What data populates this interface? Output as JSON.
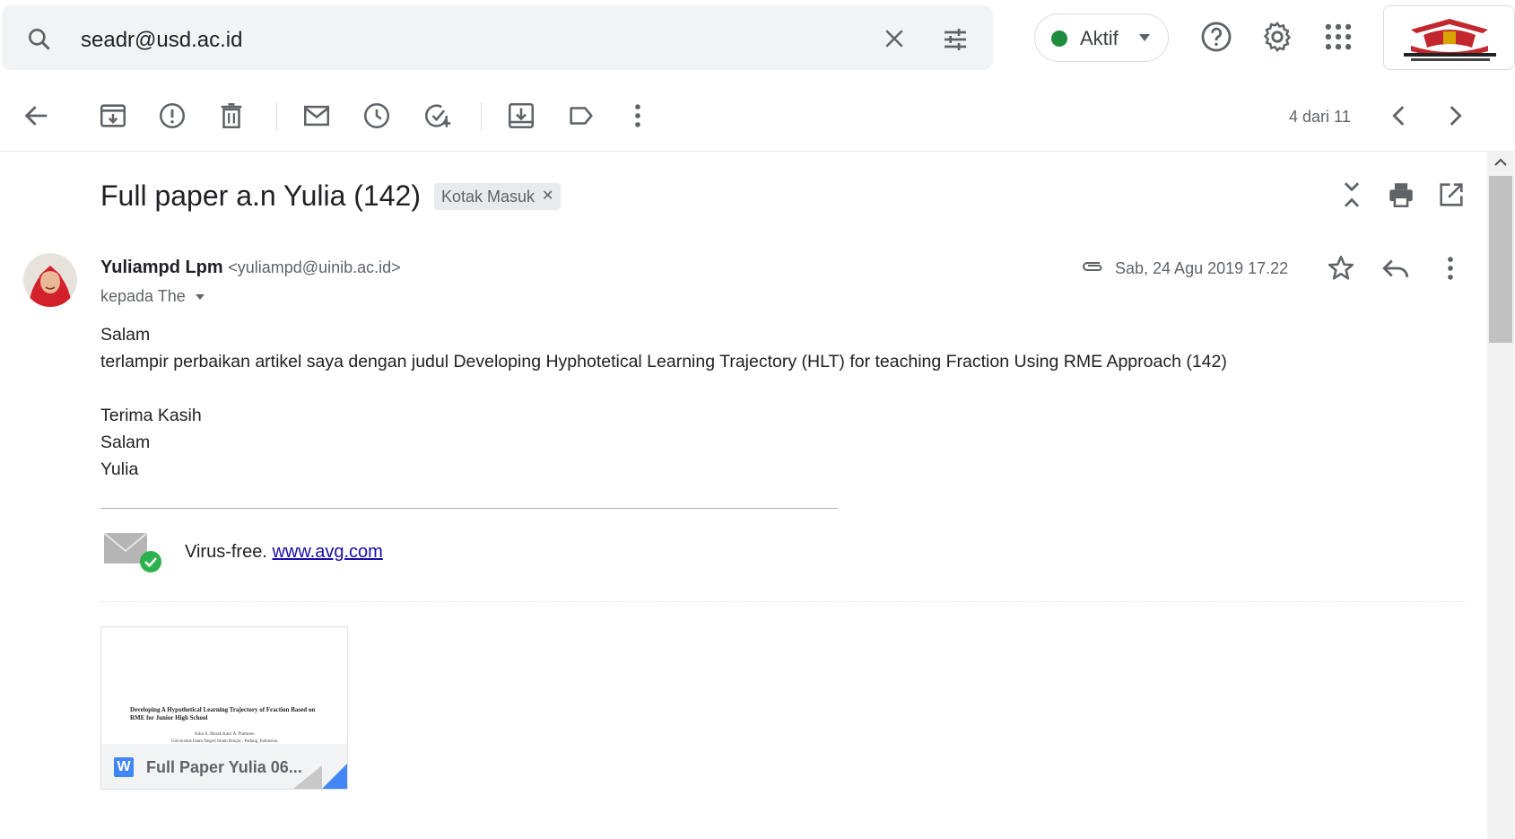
{
  "search": {
    "query": "seadr@usd.ac.id"
  },
  "status": {
    "label": "Aktif",
    "color": "#1e8e3e"
  },
  "toolbar": {
    "pager": "4 dari 11"
  },
  "email": {
    "subject": "Full paper a.n Yulia (142)",
    "label_chip": "Kotak Masuk",
    "sender_name": "Yuliampd Lpm",
    "sender_email": "<yuliampd@uinib.ac.id>",
    "to_text": "kepada The",
    "date": "Sab, 24 Agu 2019 17.22",
    "body_lines": [
      "Salam",
      "terlampir perbaikan artikel saya dengan judul Developing Hyphotetical Learning Trajectory (HLT) for teaching Fraction Using RME Approach (142)",
      "",
      "Terima Kasih",
      "Salam",
      "Yulia"
    ],
    "virus_free_text": "Virus-free.",
    "virus_free_link": "www.avg.com"
  },
  "attachment": {
    "filename": "Full Paper Yulia 06...",
    "type_letter": "W",
    "preview_title": "Developing A Hypothetical Learning Trajectory of Fraction Based on RME for Junior High School",
    "preview_authors": "Yulia  A. Marak  Kairi  A. Pramono",
    "preview_affil": "Universitas Islam Negeri Imam Bonjol , Padang, Indonesia"
  },
  "logo_text": "UNIVERSITAS ISLAM NEGERI IMAM BONJOL PADANG",
  "colors": {
    "accent": "#1a73e8",
    "icon": "#5f6368"
  }
}
